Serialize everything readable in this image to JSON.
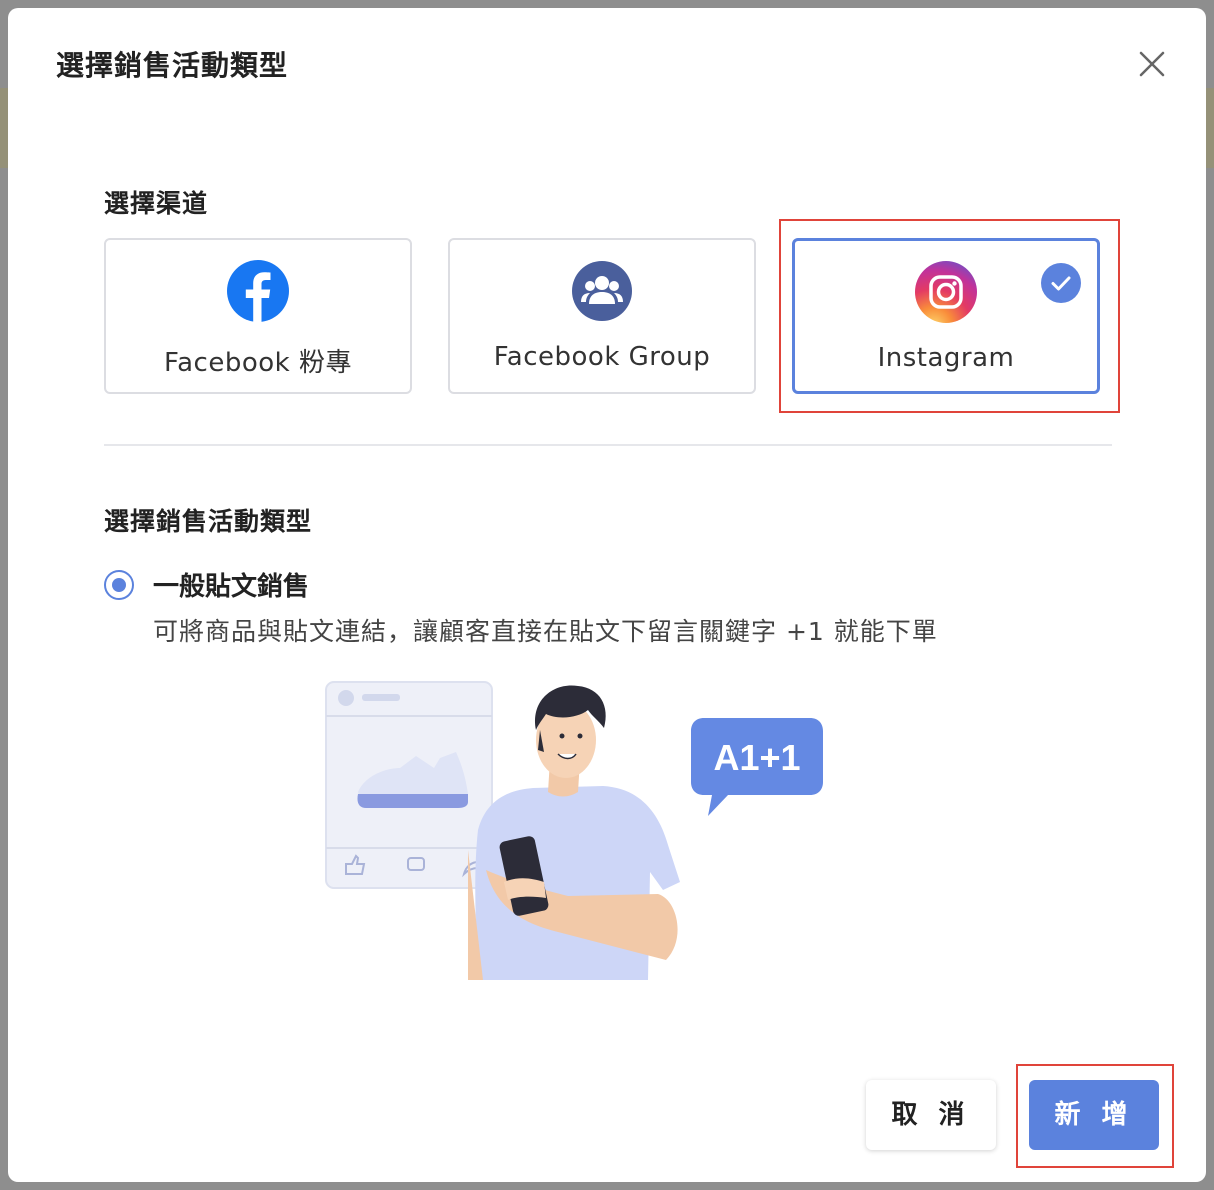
{
  "modal": {
    "title": "選擇銷售活動類型"
  },
  "channel_section": {
    "label": "選擇渠道",
    "options": [
      {
        "label": "Facebook 粉專",
        "icon": "facebook-icon",
        "selected": false
      },
      {
        "label": "Facebook Group",
        "icon": "group-icon",
        "selected": false
      },
      {
        "label": "Instagram",
        "icon": "instagram-icon",
        "selected": true
      }
    ]
  },
  "type_section": {
    "label": "選擇銷售活動類型",
    "options": [
      {
        "title": "一般貼文銷售",
        "description": "可將商品與貼文連結，讓顧客直接在貼文下留言關鍵字 +1 就能下單",
        "selected": true
      }
    ]
  },
  "illustration": {
    "bubble_text": "A1+1"
  },
  "footer": {
    "cancel_label": "取 消",
    "create_label": "新 增"
  },
  "colors": {
    "accent": "#5b82dd",
    "highlight": "#e0443a",
    "facebook": "#1877f2",
    "group": "#4a5f9c"
  }
}
